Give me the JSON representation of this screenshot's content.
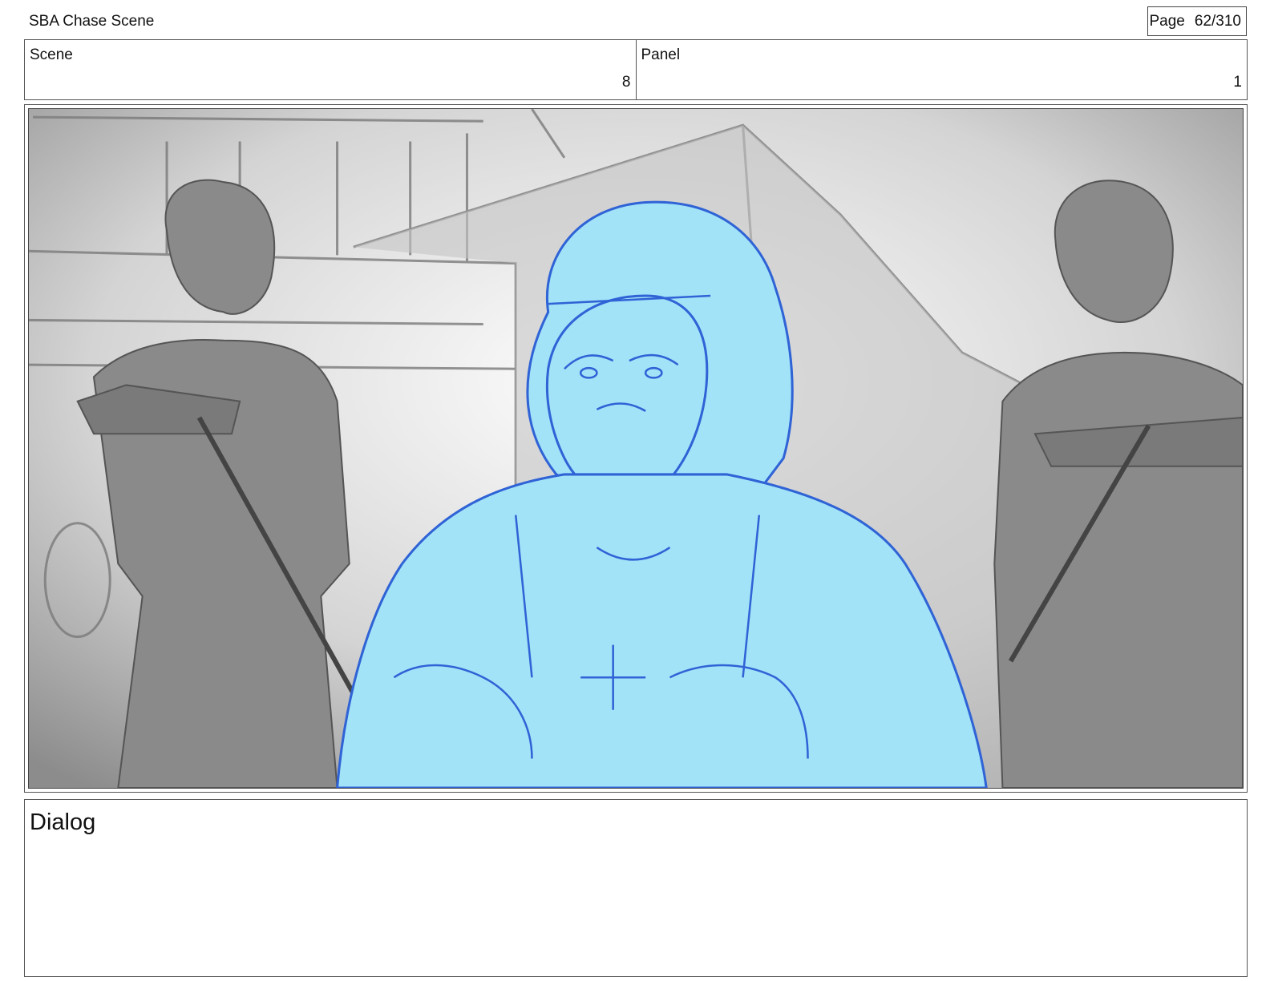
{
  "header": {
    "project_title": "SBA Chase Scene",
    "page_label": "Page",
    "page_number": "62/310"
  },
  "info_row": {
    "scene_label": "Scene",
    "scene_value": "8",
    "panel_label": "Panel",
    "panel_value": "1"
  },
  "panel": {
    "colors": {
      "character_fill": "#a3e3f8",
      "character_line": "#2f63d6",
      "background": "#d9d9d9",
      "figure_gray": "#8a8a8a"
    }
  },
  "dialog": {
    "label": "Dialog",
    "text": ""
  }
}
